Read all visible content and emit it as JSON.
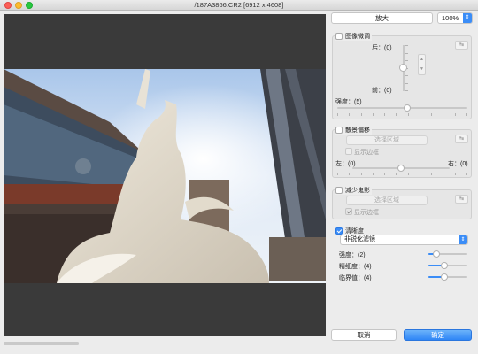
{
  "window": {
    "title": "/187A3866.CR2 [6912 x 4608]"
  },
  "zoom": {
    "button_label": "放大",
    "value": "100%"
  },
  "fine_tune": {
    "title": "图像微调",
    "checked": false,
    "back_label": "后：(0)",
    "front_label": "前：(0)",
    "strength_label": "强度：(5)",
    "strength_value": 5
  },
  "bokeh_shift": {
    "title": "散景偏移",
    "checked": false,
    "select_area": "选择区域",
    "show_border": "显示边框",
    "left_label": "左：(0)",
    "right_label": "右：(0)"
  },
  "ghosting": {
    "title": "减少鬼影",
    "checked": false,
    "select_area": "选择区域",
    "show_border": "显示边框",
    "show_border_checked": true
  },
  "sharpness": {
    "title": "清晰度",
    "checked": true,
    "filter": "非锐化滤镜",
    "strength_label": "强度：(2)",
    "fineness_label": "精细度：(4)",
    "threshold_label": "临界值：(4)",
    "strength_value": 2,
    "fineness_value": 4,
    "threshold_value": 4
  },
  "buttons": {
    "cancel": "取消",
    "ok": "确定"
  },
  "colors": {
    "accent": "#3b8df7"
  }
}
